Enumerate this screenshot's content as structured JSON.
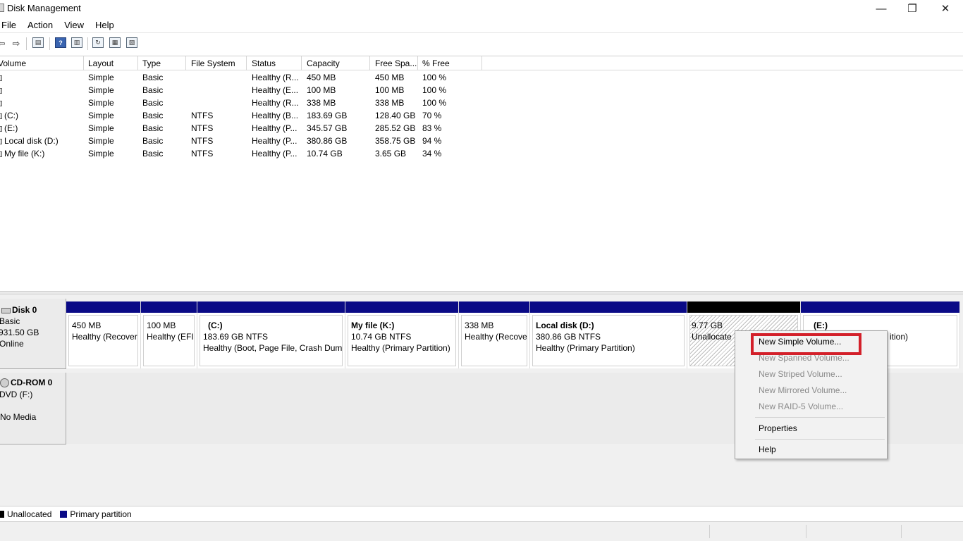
{
  "window": {
    "title": "Disk Management",
    "minimize": "—",
    "restore": "❐",
    "close": "✕"
  },
  "menu": [
    "File",
    "Action",
    "View",
    "Help"
  ],
  "toolbar": {
    "back": "⇦",
    "forward": "⇨",
    "help": "?"
  },
  "volume_table": {
    "headers": [
      "Volume",
      "Layout",
      "Type",
      "File System",
      "Status",
      "Capacity",
      "Free Spa...",
      "% Free"
    ],
    "rows": [
      {
        "volume": "",
        "layout": "Simple",
        "type": "Basic",
        "fs": "",
        "status": "Healthy (R...",
        "capacity": "450 MB",
        "free": "450 MB",
        "pct": "100 %"
      },
      {
        "volume": "",
        "layout": "Simple",
        "type": "Basic",
        "fs": "",
        "status": "Healthy (E...",
        "capacity": "100 MB",
        "free": "100 MB",
        "pct": "100 %"
      },
      {
        "volume": "",
        "layout": "Simple",
        "type": "Basic",
        "fs": "",
        "status": "Healthy (R...",
        "capacity": "338 MB",
        "free": "338 MB",
        "pct": "100 %"
      },
      {
        "volume": "(C:)",
        "layout": "Simple",
        "type": "Basic",
        "fs": "NTFS",
        "status": "Healthy (B...",
        "capacity": "183.69 GB",
        "free": "128.40 GB",
        "pct": "70 %"
      },
      {
        "volume": "(E:)",
        "layout": "Simple",
        "type": "Basic",
        "fs": "NTFS",
        "status": "Healthy (P...",
        "capacity": "345.57 GB",
        "free": "285.52 GB",
        "pct": "83 %"
      },
      {
        "volume": "Local disk (D:)",
        "layout": "Simple",
        "type": "Basic",
        "fs": "NTFS",
        "status": "Healthy (P...",
        "capacity": "380.86 GB",
        "free": "358.75 GB",
        "pct": "94 %"
      },
      {
        "volume": "My file (K:)",
        "layout": "Simple",
        "type": "Basic",
        "fs": "NTFS",
        "status": "Healthy (P...",
        "capacity": "10.74 GB",
        "free": "3.65 GB",
        "pct": "34 %"
      }
    ]
  },
  "disk0": {
    "name": "Disk 0",
    "type": "Basic",
    "size": "931.50 GB",
    "state": "Online",
    "partitions": [
      {
        "title": "",
        "size": "450 MB",
        "status": "Healthy (Recover"
      },
      {
        "title": "",
        "size": "100 MB",
        "status": "Healthy (EFI"
      },
      {
        "title": "(C:)",
        "size": "183.69 GB NTFS",
        "status": "Healthy (Boot, Page File, Crash Dum"
      },
      {
        "title": "My file  (K:)",
        "size": "10.74 GB NTFS",
        "status": "Healthy (Primary Partition)"
      },
      {
        "title": "",
        "size": "338 MB",
        "status": "Healthy (Recove"
      },
      {
        "title": "Local disk  (D:)",
        "size": "380.86 GB NTFS",
        "status": "Healthy (Primary Partition)"
      },
      {
        "title": "",
        "size": "9.77 GB",
        "status": "Unallocate"
      },
      {
        "title": "(E:)",
        "size": "",
        "status": "ition)"
      }
    ]
  },
  "cdrom": {
    "name": "CD-ROM 0",
    "drive": "DVD (F:)",
    "media": "No Media"
  },
  "legend": [
    {
      "label": "Unallocated",
      "color": "#000000"
    },
    {
      "label": "Primary partition",
      "color": "#0a0a86"
    }
  ],
  "context_menu": {
    "items": [
      {
        "label": "New Simple Volume...",
        "enabled": true
      },
      {
        "label": "New Spanned Volume...",
        "enabled": false
      },
      {
        "label": "New Striped Volume...",
        "enabled": false
      },
      {
        "label": "New Mirrored Volume...",
        "enabled": false
      },
      {
        "label": "New RAID-5 Volume...",
        "enabled": false
      },
      {
        "label": "Properties",
        "enabled": true
      },
      {
        "label": "Help",
        "enabled": true
      }
    ],
    "highlight_color": "#d3202a"
  }
}
